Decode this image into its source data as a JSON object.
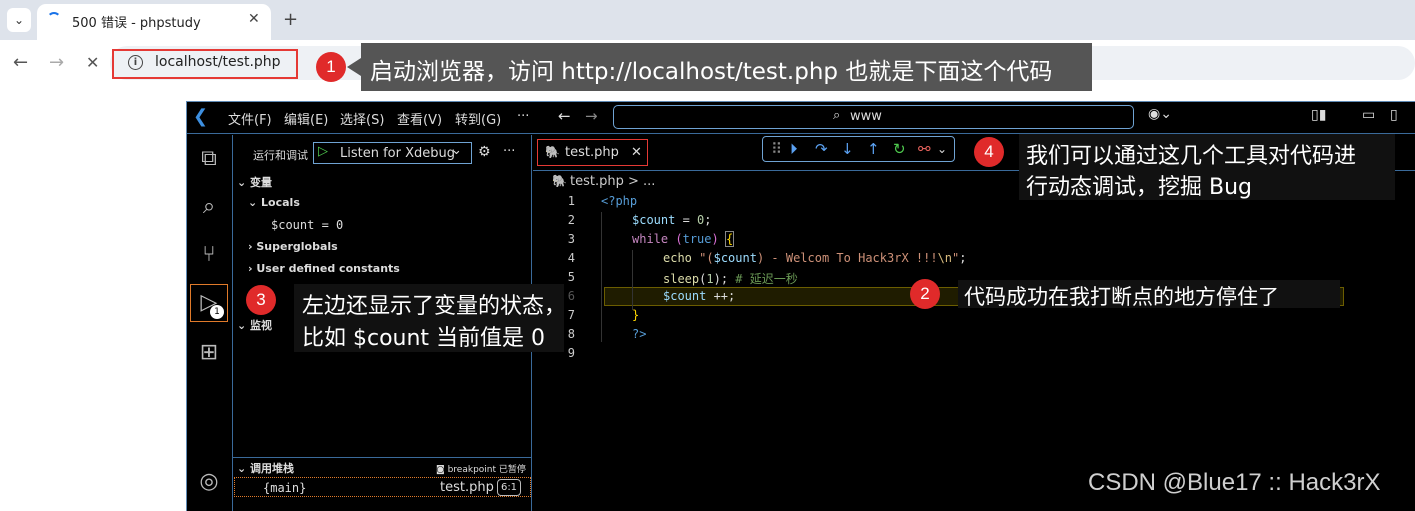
{
  "browser": {
    "tab_title": "500 错误 - phpstudy",
    "url": "localhost/test.php",
    "close_glyph": "✕",
    "newtab_glyph": "+",
    "back_glyph": "←",
    "forward_glyph": "→",
    "stop_glyph": "✕",
    "dropdown_glyph": "⌄"
  },
  "callouts": {
    "c1_num": "1",
    "c1_text": "启动浏览器，访问 http://localhost/test.php 也就是下面这个代码",
    "c2_num": "2",
    "c2_text": "代码成功在我打断点的地方停住了",
    "c3_num": "3",
    "c3_line1": "左边还显示了变量的状态，",
    "c3_line2": "比如 $count 当前值是 0",
    "c4_num": "4",
    "c4_line1": "我们可以通过这几个工具对代码进",
    "c4_line2": "行动态调试，挖掘 Bug"
  },
  "vscode": {
    "menus": [
      "文件(F)",
      "编辑(E)",
      "选择(S)",
      "查看(V)",
      "转到(G)",
      "···"
    ],
    "search_text": "www",
    "sidebar": {
      "run_debug_label": "运行和调试",
      "config": "Listen for Xdebug",
      "variables_header": "变量",
      "locals": "Locals",
      "count_var": "$count = 0",
      "superglobals": "Superglobals",
      "user_constants": "User defined constants",
      "watch_header": "监视",
      "callstack_header": "调用堆栈",
      "breakpoint_status": "breakpoint 已暂停",
      "frame_name": "{main}",
      "frame_file": "test.php",
      "frame_pos": "6:1"
    },
    "editor": {
      "tab_label": "test.php",
      "breadcrumb": "test.php > ...",
      "line_numbers": [
        "1",
        "2",
        "3",
        "4",
        "5",
        "6",
        "7",
        "8",
        "9"
      ],
      "current_line": 6
    },
    "debug_badge": "1"
  },
  "watermark": "CSDN @Blue17 :: Hack3rX",
  "colors": {
    "badge_red": "#e02a2a",
    "highlight": "#6b5d00",
    "keyword": "#569cd6",
    "string": "#ce9178",
    "comment": "#6a9955"
  }
}
